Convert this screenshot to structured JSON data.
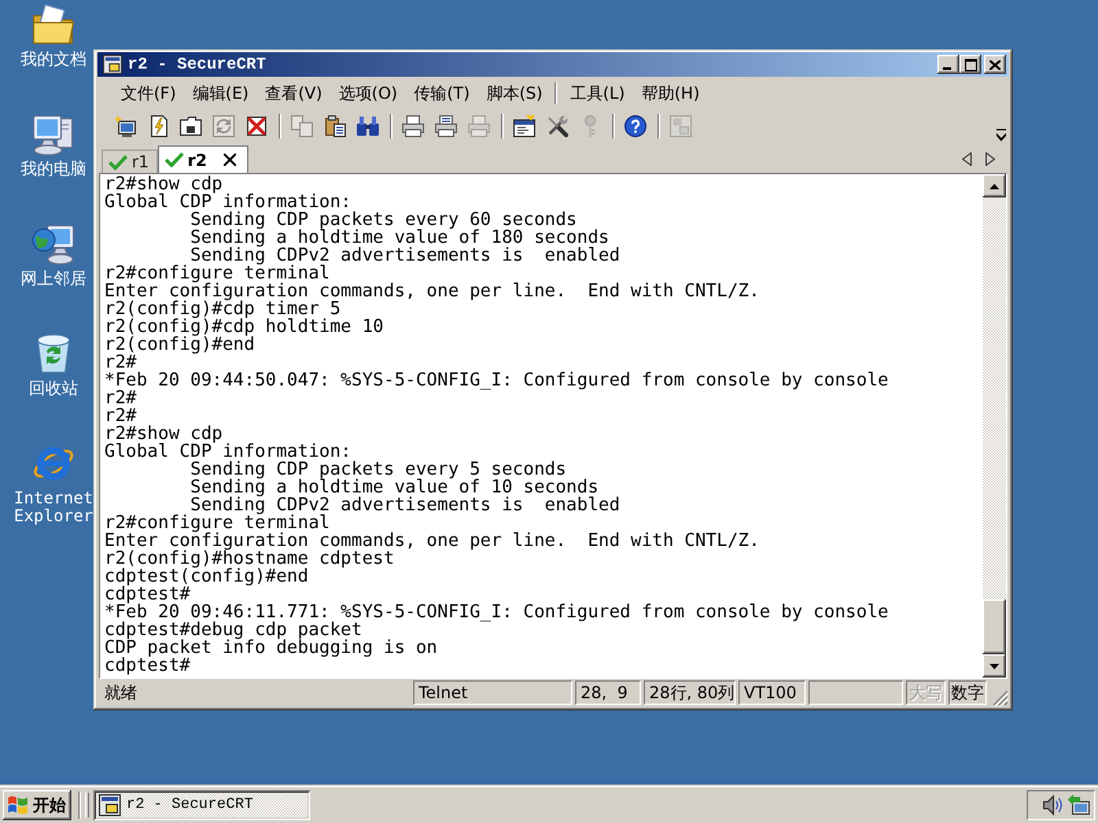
{
  "desktop": {
    "icons": [
      {
        "kind": "documents",
        "label": "我的文档"
      },
      {
        "kind": "computer",
        "label": "我的电脑"
      },
      {
        "kind": "network",
        "label": "网上邻居"
      },
      {
        "kind": "recycle",
        "label": "回收站"
      },
      {
        "kind": "browser",
        "label": "Internet Explorer"
      }
    ]
  },
  "window": {
    "title": "r2 - SecureCRT",
    "active": true,
    "menu_groups": [
      [
        "文件(F)",
        "编辑(E)",
        "查看(V)",
        "选项(O)",
        "传输(T)",
        "脚本(S)"
      ],
      [
        "工具(L)",
        "帮助(H)"
      ]
    ],
    "toolbar_groups": [
      [
        {
          "kind": "connect",
          "disabled": false
        },
        {
          "kind": "quick_connect",
          "disabled": false
        },
        {
          "kind": "connect_tab",
          "disabled": false
        },
        {
          "kind": "reconnect",
          "disabled": true
        },
        {
          "kind": "disconnect",
          "disabled": false
        }
      ],
      [
        {
          "kind": "copy",
          "disabled": true
        },
        {
          "kind": "paste",
          "disabled": false
        },
        {
          "kind": "find",
          "disabled": false
        }
      ],
      [
        {
          "kind": "print",
          "disabled": false
        },
        {
          "kind": "print_selection",
          "disabled": false
        },
        {
          "kind": "print_setup",
          "disabled": true
        }
      ],
      [
        {
          "kind": "session_options",
          "disabled": false
        },
        {
          "kind": "global_options",
          "disabled": false
        },
        {
          "kind": "key",
          "disabled": true
        }
      ],
      [
        {
          "kind": "help",
          "disabled": false
        }
      ],
      [
        {
          "kind": "keymap",
          "disabled": true
        }
      ]
    ],
    "tabs": [
      {
        "label": "r1",
        "selected": false,
        "connected": true
      },
      {
        "label": "r2",
        "selected": true,
        "connected": true
      }
    ],
    "terminal": {
      "lines": [
        "r2#show cdp",
        "Global CDP information:",
        "        Sending CDP packets every 60 seconds",
        "        Sending a holdtime value of 180 seconds",
        "        Sending CDPv2 advertisements is  enabled",
        "r2#configure terminal",
        "Enter configuration commands, one per line.  End with CNTL/Z.",
        "r2(config)#cdp timer 5",
        "r2(config)#cdp holdtime 10",
        "r2(config)#end",
        "r2#",
        "*Feb 20 09:44:50.047: %SYS-5-CONFIG_I: Configured from console by console",
        "r2#",
        "r2#",
        "r2#show cdp",
        "Global CDP information:",
        "        Sending CDP packets every 5 seconds",
        "        Sending a holdtime value of 10 seconds",
        "        Sending CDPv2 advertisements is  enabled",
        "r2#configure terminal",
        "Enter configuration commands, one per line.  End with CNTL/Z.",
        "r2(config)#hostname cdptest",
        "cdptest(config)#end",
        "cdptest#",
        "*Feb 20 09:46:11.771: %SYS-5-CONFIG_I: Configured from console by console",
        "cdptest#debug cdp packet",
        "CDP packet info debugging is on",
        "cdptest#"
      ]
    },
    "status_bar": {
      "message": "就绪",
      "panels": [
        {
          "kind": "text",
          "text": "Telnet"
        },
        {
          "kind": "text",
          "text": "28,  9"
        },
        {
          "kind": "text",
          "text": "28行, 80列"
        },
        {
          "kind": "text",
          "text": "VT100"
        },
        {
          "kind": "blank"
        },
        {
          "kind": "key",
          "text": "大写",
          "on": false
        },
        {
          "kind": "key",
          "text": "数字",
          "on": true
        }
      ]
    }
  },
  "taskbar": {
    "start_label": "开始",
    "tasks": [
      {
        "label": "r2 - SecureCRT",
        "selected": true
      }
    ]
  }
}
